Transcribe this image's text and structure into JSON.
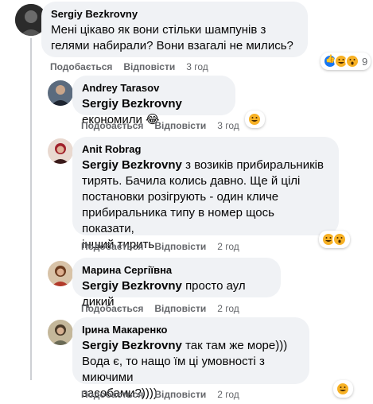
{
  "comments": [
    {
      "author": "Sergiy Bezkrovny",
      "text": "Мені цікаво як вони стільки шампунів з гелями набирали? Вони взагалі не мились?",
      "like_label": "Подобається",
      "reply_label": "Відповісти",
      "time": "3 год",
      "reactions": [
        "like",
        "haha",
        "wow"
      ],
      "reaction_count": "9"
    },
    {
      "author": "Andrey Tarasov",
      "mention": "Sergiy Bezkrovny",
      "text": "економили 😂",
      "like_label": "Подобається",
      "reply_label": "Відповісти",
      "time": "3 год",
      "reactions": [
        "haha"
      ]
    },
    {
      "author": "Anit Robrag",
      "mention": "Sergiy Bezkrovny",
      "text_line1": "з возиків прибиральників",
      "text_rest": [
        "тирять. Бачила колись давно. Ще й цілі",
        "постановки розігрують - один кличе",
        "прибиральника типу в номер щось показати,",
        "інший тирить"
      ],
      "like_label": "Подобається",
      "reply_label": "Відповісти",
      "time": "2 год",
      "reactions": [
        "haha",
        "wow"
      ]
    },
    {
      "author": "Марина Сергіївна",
      "mention": "Sergiy Bezkrovny",
      "text": "просто аул дикий",
      "like_label": "Подобається",
      "reply_label": "Відповісти",
      "time": "2 год"
    },
    {
      "author": "Ірина Макаренко",
      "mention": "Sergiy Bezkrovny",
      "text_line1": "так там же море)))",
      "text_rest": [
        "Вода є, то нащо їм ці умовності з миючими",
        "засобами?))))"
      ],
      "like_label": "Подобається",
      "reply_label": "Відповісти",
      "time": "2 год",
      "reactions": [
        "haha"
      ]
    }
  ],
  "colors": {
    "bubble": "#f0f2f5",
    "secondary_text": "#65676b",
    "like_blue": "#1877f2",
    "emoji_yellow": "#f7b125"
  }
}
